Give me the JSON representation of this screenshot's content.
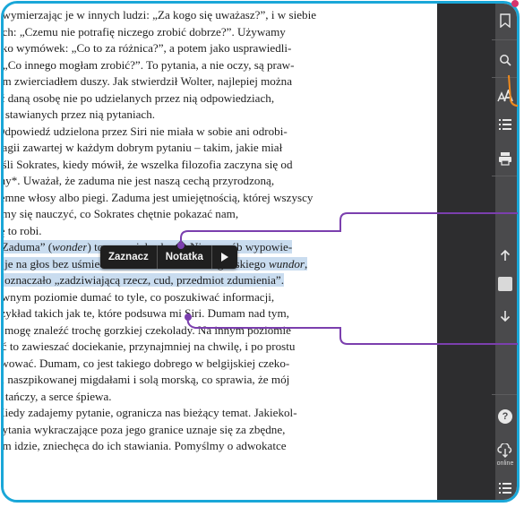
{
  "reader": {
    "lines": [
      {
        "segments": [
          {
            "t": ", wymierzając je w innych ludzi: „Za kogo się uważasz?”, i w siebie",
            "h": false
          }
        ]
      },
      {
        "segments": [
          {
            "t": "ych: „Czemu nie potrafię niczego zrobić dobrze?”. Używamy",
            "h": false
          }
        ]
      },
      {
        "segments": [
          {
            "t": "ako wymówek: „Co to za różnica?”, a potem jako usprawiedli-",
            "h": false
          }
        ]
      },
      {
        "segments": [
          {
            "t": ": „Co innego mogłam zrobić?”. To pytania, a nie oczy, są praw-",
            "h": false
          }
        ]
      },
      {
        "segments": [
          {
            "t": "ym zwierciadłem duszy. Jak stwierdził Wolter, najlepiej można",
            "h": false
          }
        ]
      },
      {
        "segments": [
          {
            "t": "ić daną osobę nie po udzielanych przez nią odpowiedziach,",
            "h": false
          }
        ]
      },
      {
        "segments": [
          {
            "t": "o stawianych przez nią pytaniach.",
            "h": false
          }
        ]
      },
      {
        "segments": [
          {
            "t": "Odpowiedź udzielona przez Siri nie miała w sobie ani odrobi-",
            "h": false
          }
        ]
      },
      {
        "segments": [
          {
            "t": "nagii zawartej w każdym dobrym pytaniu – takim, jakie miał",
            "h": false
          }
        ]
      },
      {
        "segments": [
          {
            "t": "yśli Sokrates, kiedy mówił, że wszelka filozofia zaczyna się od",
            "h": false
          }
        ]
      },
      {
        "segments": [
          {
            "t": "my*. Uważał, że zaduma nie jest naszą cechą przyrodzoną,",
            "h": false
          }
        ]
      },
      {
        "segments": [
          {
            "t": "jemne włosy albo piegi. Zaduma jest umiejętnością, której wszyscy",
            "h": false
          }
        ]
      },
      {
        "segments": [
          {
            "t": "emy się nauczyć, co Sokrates chętnie pokazać nam,",
            "h": false
          }
        ]
      },
      {
        "segments": [
          {
            "t": "ię to robi.",
            "h": false
          }
        ]
      },
      {
        "segments": [
          {
            "t": "„Zaduma” (",
            "h": true
          },
          {
            "t": "wonder",
            "h": true,
            "i": true
          },
          {
            "t": ") to wspaniałe słowo. Nie sposób wypowie-",
            "h": true
          }
        ]
      },
      {
        "segments": [
          {
            "t": "ć je na głos bez uśmiechu. Pochodzi od staroangielskiego ",
            "h": true
          },
          {
            "t": "wundor",
            "h": true,
            "i": true
          },
          {
            "t": ",",
            "h": true
          }
        ]
      },
      {
        "segments": [
          {
            "t": "e oznaczało „zadziwiającą rzecz, cud, przedmiot zdumienia”.",
            "h": true
          }
        ]
      },
      {
        "segments": [
          {
            "t": "ewnym poziomie dumać to tyle, co poszukiwać informacji,",
            "h": false
          }
        ]
      },
      {
        "segments": [
          {
            "t": "rzykład takich jak te, które podsuwa mi Siri. Dumam nad tym,",
            "h": false
          }
        ]
      },
      {
        "segments": [
          {
            "t": "e mogę znaleźć trochę gorzkiej czekolady. Na innym poziomie",
            "h": false
          }
        ]
      },
      {
        "segments": [
          {
            "t": "ać to zawieszać dociekanie, przynajmniej na chwilę, i po prostu",
            "h": false
          }
        ]
      },
      {
        "segments": [
          {
            "t": "rwować. Dumam, co jest takiego dobrego w belgijskiej czeko-",
            "h": false
          }
        ]
      },
      {
        "segments": [
          {
            "t": "e, naszpikowanej migdałami i solą morską, co sprawia, że mój",
            "h": false
          }
        ]
      },
      {
        "segments": [
          {
            "t": "g tańczy, a serce śpiewa.",
            "h": false
          }
        ]
      },
      {
        "segments": [
          {
            "t": "Kiedy zadajemy pytanie, ogranicza nas bieżący temat. Jakiekol-",
            "h": false
          }
        ]
      },
      {
        "segments": [
          {
            "t": "pytania wykraczające poza jego granice uznaje się za zbędne,",
            "h": false
          }
        ]
      },
      {
        "segments": [
          {
            "t": "ym idzie, zniechęca do ich stawiania. Pomyślmy o adwokatce",
            "h": false
          }
        ]
      }
    ]
  },
  "popup": {
    "mark_label": "Zaznacz",
    "note_label": "Notatka",
    "more_icon": "play-triangle-icon"
  },
  "toolbar": {
    "icons": [
      "bookmark-icon",
      "search-icon",
      "font-size-icon",
      "table-of-contents-icon",
      "print-icon",
      "arrow-up-icon",
      "page-indicator",
      "arrow-down-icon",
      "help-icon",
      "cloud-sync-icon",
      "menu-icon"
    ],
    "online_label": "online",
    "help_label": "?"
  },
  "colors": {
    "frame": "#1aa7d8",
    "highlight": "#c9dcef",
    "callout_purple": "#7b3fae",
    "callout_orange": "#f08a1c",
    "toolbar_bg": "#4a4a4c",
    "sidebar_bg": "#2d2d2f"
  }
}
